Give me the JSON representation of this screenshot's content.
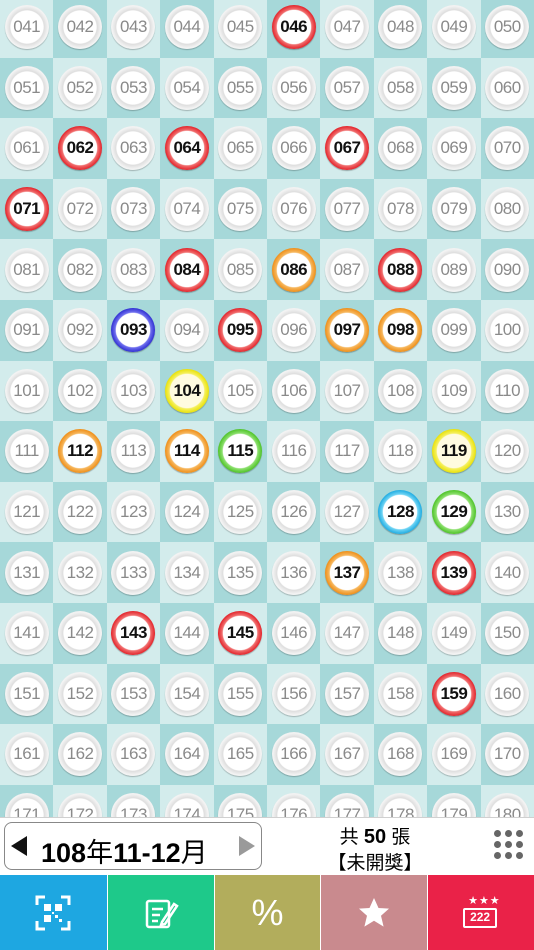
{
  "grid": {
    "start_number": 41,
    "end_number": 180,
    "columns": 10,
    "highlighted": {
      "046": "red",
      "062": "red",
      "064": "red",
      "067": "red",
      "071": "red",
      "084": "red",
      "086": "orange",
      "088": "red",
      "093": "blue",
      "095": "red",
      "097": "orange",
      "098": "orange",
      "104": "yellow",
      "112": "orange",
      "114": "orange",
      "115": "green",
      "119": "yellow",
      "128": "cyan",
      "129": "green",
      "137": "orange",
      "139": "red",
      "143": "red",
      "145": "red",
      "159": "red"
    },
    "colors": {
      "red": "#e21c24",
      "orange": "#ee8a10",
      "yellow": "#e8e000",
      "green": "#48c020",
      "blue": "#2a2ad0",
      "cyan": "#18a8e0",
      "cell_dark": "#a6d8d9",
      "cell_light": "#d3ecec"
    }
  },
  "status_bar": {
    "period": {
      "year": "108",
      "year_suffix": "年",
      "months": "11-12",
      "month_suffix": "月"
    },
    "count": {
      "prefix": "共",
      "value": "50",
      "suffix": "張"
    },
    "draw_status": "【未開獎】",
    "prev_icon": "left-triangle-icon",
    "next_icon": "right-triangle-icon",
    "menu_icon": "grid-dots-icon"
  },
  "toolbar": [
    {
      "icon": "qr-scan-icon",
      "color": "#1ea7e1"
    },
    {
      "icon": "edit-note-icon",
      "color": "#1ec98a"
    },
    {
      "icon": "percent-icon",
      "color": "#b2ad5c",
      "glyph": "%"
    },
    {
      "icon": "star-icon",
      "color": "#c98a8e"
    },
    {
      "icon": "lottery-ticket-icon",
      "color": "#ea2248",
      "glyph": "222"
    }
  ]
}
